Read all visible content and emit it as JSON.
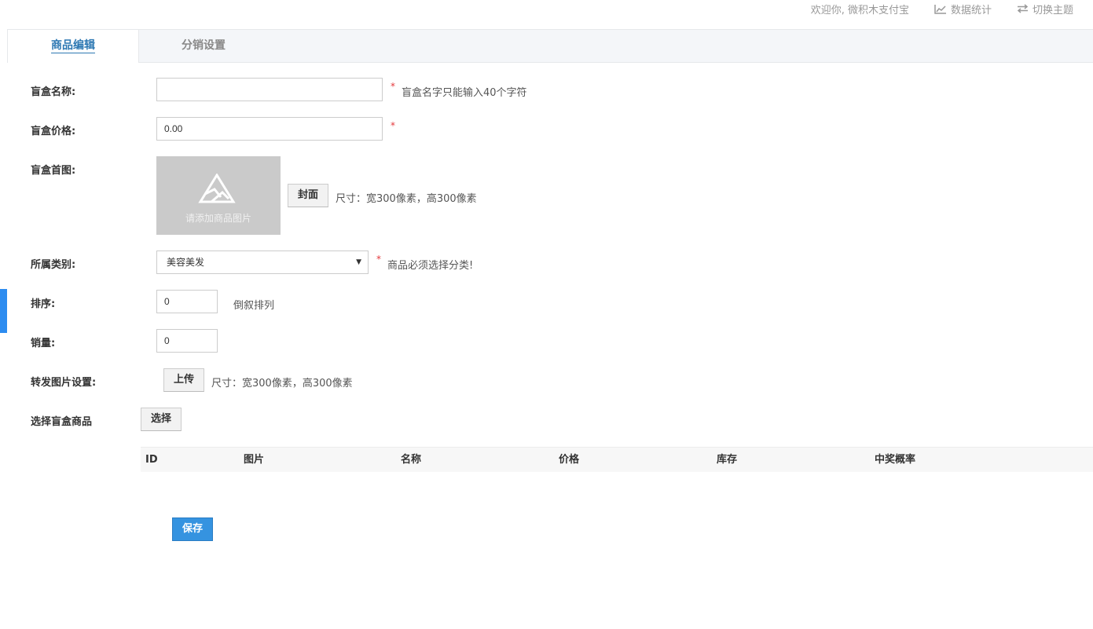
{
  "header": {
    "welcome": "欢迎你, 微积木支付宝",
    "stats_label": "数据统计",
    "theme_label": "切换主题"
  },
  "tabs": [
    {
      "label": "商品编辑",
      "active": true
    },
    {
      "label": "分销设置",
      "active": false
    }
  ],
  "form": {
    "name": {
      "label": "盲盒名称:",
      "value": "",
      "hint": "盲盒名字只能输入40个字符"
    },
    "price": {
      "label": "盲盒价格:",
      "value": "0.00"
    },
    "cover": {
      "label": "盲盒首图:",
      "placeholder_text": "请添加商品图片",
      "button": "封面",
      "hint": "尺寸：宽300像素，高300像素"
    },
    "category": {
      "label": "所属类别:",
      "value": "美容美发",
      "hint": "商品必须选择分类!"
    },
    "sort": {
      "label": "排序:",
      "value": "0",
      "hint": "倒叙排列"
    },
    "sales": {
      "label": "销量:",
      "value": "0"
    },
    "share_image": {
      "label": "转发图片设置:",
      "button": "上传",
      "hint": "尺寸：宽300像素，高300像素"
    },
    "select_goods": {
      "label": "选择盲盒商品",
      "button": "选择"
    },
    "required_mark": "*"
  },
  "table": {
    "columns": [
      "ID",
      "图片",
      "名称",
      "价格",
      "库存",
      "中奖概率"
    ],
    "rows": []
  },
  "save_label": "保存",
  "colors": {
    "accent": "#2d78b3",
    "primary_button": "#3593e0",
    "required": "#e4393c",
    "side_marker": "#2d8cf0"
  }
}
